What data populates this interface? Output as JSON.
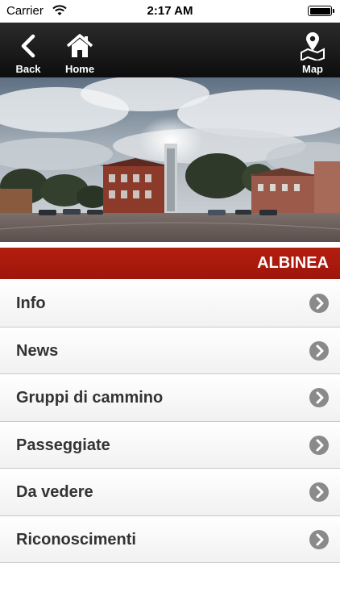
{
  "status_bar": {
    "carrier": "Carrier",
    "time": "2:17 AM"
  },
  "nav": {
    "back_label": "Back",
    "home_label": "Home",
    "map_label": "Map",
    "icons": [
      "chevron-left-icon",
      "home-icon",
      "map-pin-icon"
    ]
  },
  "hero": {
    "alt": "Town square with tower under cloudy sky"
  },
  "section": {
    "title": "ALBINEA",
    "color": "#b01b0f"
  },
  "menu": {
    "items": [
      {
        "label": "Info"
      },
      {
        "label": "News"
      },
      {
        "label": "Gruppi di cammino"
      },
      {
        "label": "Passeggiate"
      },
      {
        "label": "Da vedere"
      },
      {
        "label": "Riconoscimenti"
      }
    ]
  }
}
